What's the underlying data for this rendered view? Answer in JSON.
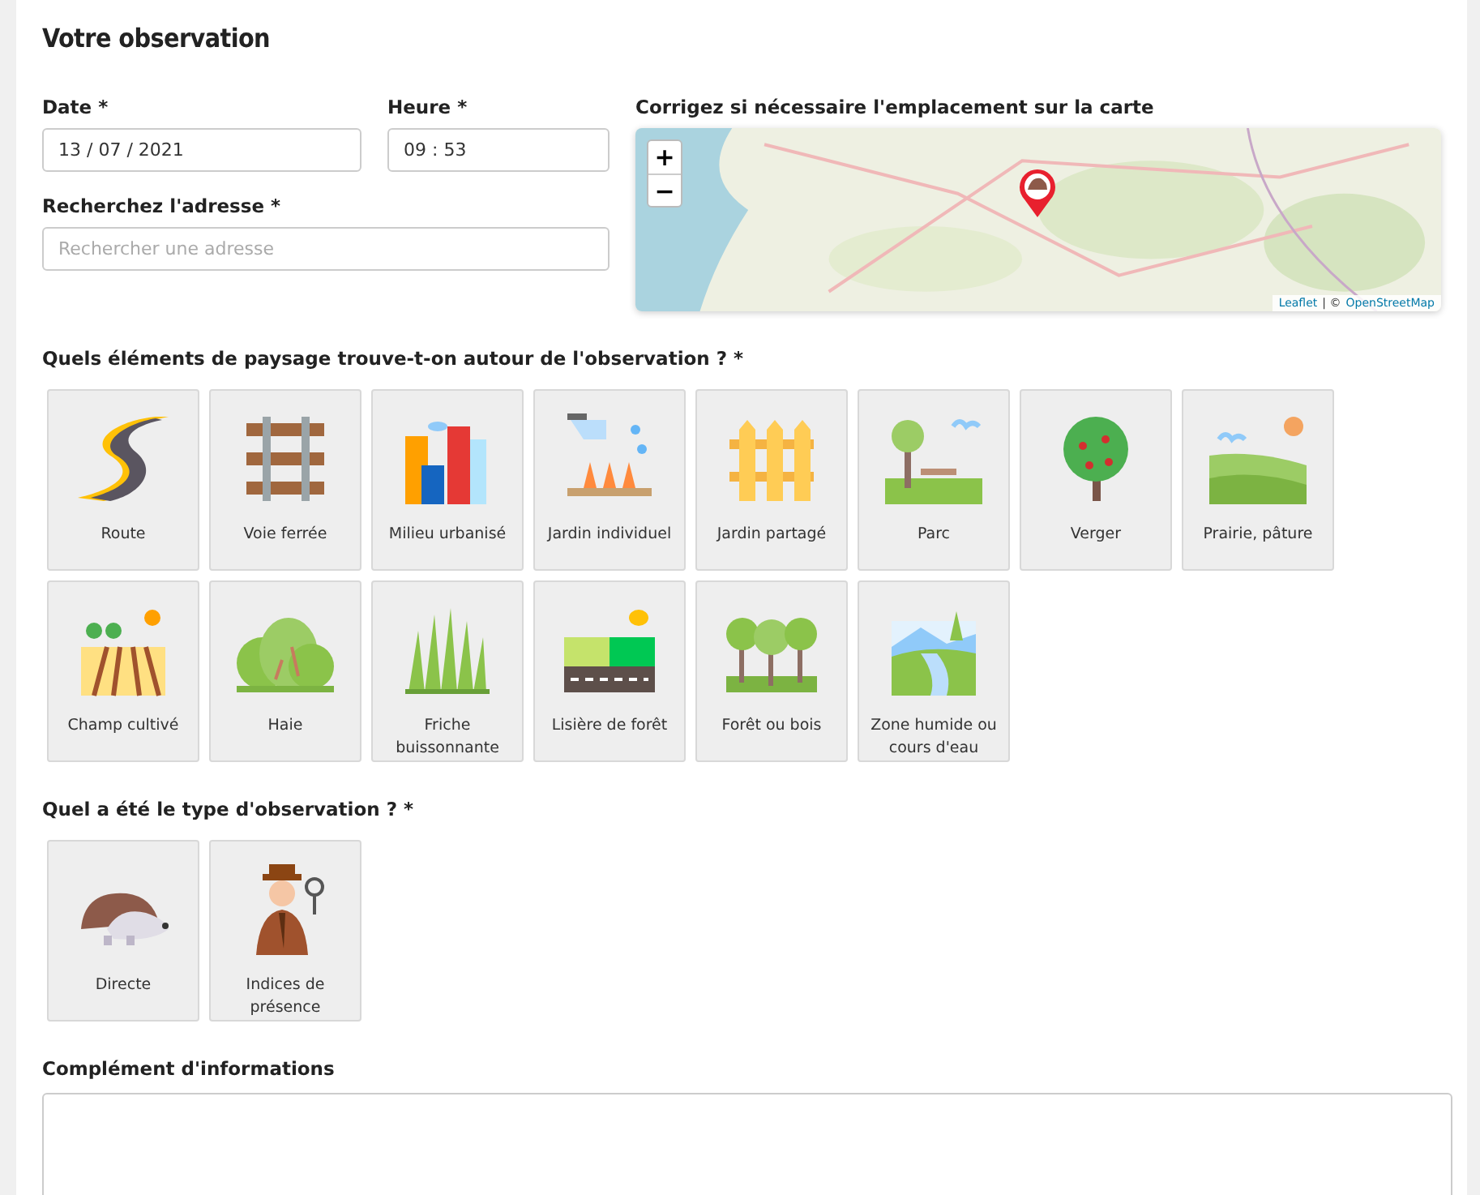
{
  "title": "Votre observation",
  "date": {
    "label": "Date *",
    "value": "13 / 07 / 2021"
  },
  "time": {
    "label": "Heure *",
    "value": "09 : 53"
  },
  "address": {
    "label": "Recherchez l'adresse *",
    "placeholder": "Rechercher une adresse"
  },
  "map": {
    "label": "Corrigez si nécessaire l'emplacement sur la carte",
    "zoom_in": "+",
    "zoom_out": "−",
    "attribution": {
      "leaflet": "Leaflet",
      "separator": "| ©",
      "osm": "OpenStreetMap"
    }
  },
  "landscape": {
    "label": "Quels éléments de paysage trouve-t-on autour de l'observation ? *",
    "items": [
      {
        "label": "Route",
        "selected": false
      },
      {
        "label": "Voie ferrée",
        "selected": false
      },
      {
        "label": "Milieu urbanisé",
        "selected": false
      },
      {
        "label": "Jardin individuel",
        "selected": false
      },
      {
        "label": "Jardin partagé",
        "selected": false
      },
      {
        "label": "Parc",
        "selected": false
      },
      {
        "label": "Verger",
        "selected": false
      },
      {
        "label": "Prairie, pâture",
        "selected": false
      },
      {
        "label": "Champ cultivé",
        "selected": false
      },
      {
        "label": "Haie",
        "selected": false
      },
      {
        "label": "Friche buissonnante",
        "selected": false
      },
      {
        "label": "Lisière de forêt",
        "selected": false
      },
      {
        "label": "Forêt ou bois",
        "selected": false
      },
      {
        "label": "Zone humide ou cours d'eau",
        "selected": false
      }
    ]
  },
  "observation_type": {
    "label": "Quel a été le type d'observation ? *",
    "items": [
      {
        "label": "Directe",
        "selected": false
      },
      {
        "label": "Indices de présence",
        "selected": false
      }
    ]
  },
  "details": {
    "label": "Complément d'informations"
  }
}
